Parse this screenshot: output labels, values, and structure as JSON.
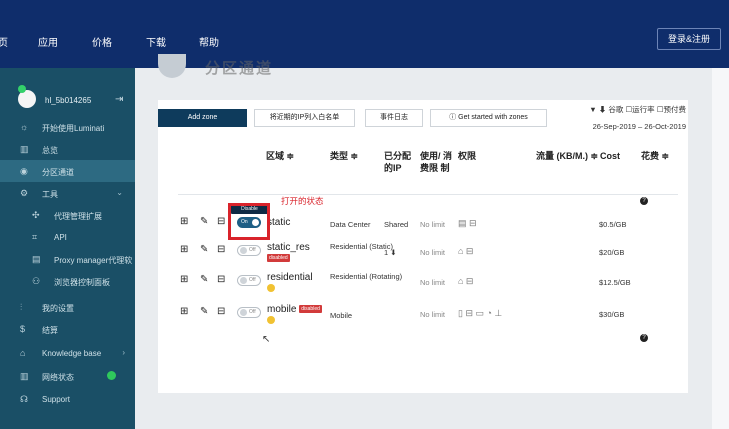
{
  "topnav": {
    "items": [
      "页",
      "应用",
      "价格",
      "下载",
      "帮助"
    ],
    "login_label": "登录&注册"
  },
  "sidebar": {
    "username": "hl_5b014265",
    "items": [
      {
        "label": "开始使用Luminati",
        "icon": "lightbulb-icon"
      },
      {
        "label": "总览",
        "icon": "bar-chart-icon"
      },
      {
        "label": "分区通道",
        "icon": "location-pin-icon",
        "active": true
      },
      {
        "label": "工具",
        "icon": "gear-icon"
      },
      {
        "label": "代理管理扩展",
        "icon": "puzzle-icon"
      },
      {
        "label": "API",
        "icon": "code-icon"
      },
      {
        "label": "Proxy manager代理软",
        "icon": "server-icon"
      },
      {
        "label": "浏览器控制面板",
        "icon": "users-icon"
      },
      {
        "label": "我的设置",
        "icon": "sliders-icon"
      },
      {
        "label": "结算",
        "icon": "dollar-icon"
      },
      {
        "label": "Knowledge base",
        "icon": "graduation-cap-icon"
      },
      {
        "label": "网络状态",
        "icon": "bar-chart-icon"
      },
      {
        "label": "Support",
        "icon": "headset-icon"
      }
    ]
  },
  "page": {
    "title": "分区通道"
  },
  "toolbar": {
    "add_zone": "Add zone",
    "whitelist": "将近期的IP列入白名单",
    "event_log": "事件日志",
    "get_started": "Get started with zones",
    "right_label": "▼ ⬇ 谷歌 ☐运行率 ☐预付费",
    "date_range": "26-Sep-2019 – 26-Oct-2019"
  },
  "table": {
    "headers": {
      "zone": "区域 ≑",
      "type": "类型 ≑",
      "ip": "已分配 的IP",
      "limit": "使用/ 消费限 制",
      "perm": "权限",
      "traffic": "流量 (KB/M.) ≑",
      "cost": "Cost",
      "spend": "花费 ≑"
    },
    "annotation": "打开的状态",
    "tooltip": "Disable",
    "rows": [
      {
        "name": "static",
        "type": "Data Center",
        "ip": "Shared",
        "limit": "No limit",
        "perm": "▤ ⊟",
        "cost": "$0.5/GB",
        "toggle": "On",
        "on": true,
        "disabled": false
      },
      {
        "name": "static_res",
        "type": "Residential (Static)",
        "ip": "1 ⬇",
        "limit": "No limit",
        "perm": "⌂ ⊟",
        "cost": "$20/GB",
        "toggle": "Off",
        "on": false,
        "disabled": true
      },
      {
        "name": "residential",
        "type": "Residential (Rotating)",
        "ip": "",
        "limit": "No limit",
        "perm": "⌂ ⊟",
        "cost": "$12.5/GB",
        "toggle": "Off",
        "on": false,
        "disabled": false
      },
      {
        "name": "mobile",
        "type": "Mobile",
        "ip": "",
        "limit": "No limit",
        "perm": "▯ ⊟ ▭ ◔ ⊥",
        "cost": "$30/GB",
        "toggle": "Off",
        "on": false,
        "disabled": true
      }
    ],
    "disabled_badge": "disabled"
  }
}
